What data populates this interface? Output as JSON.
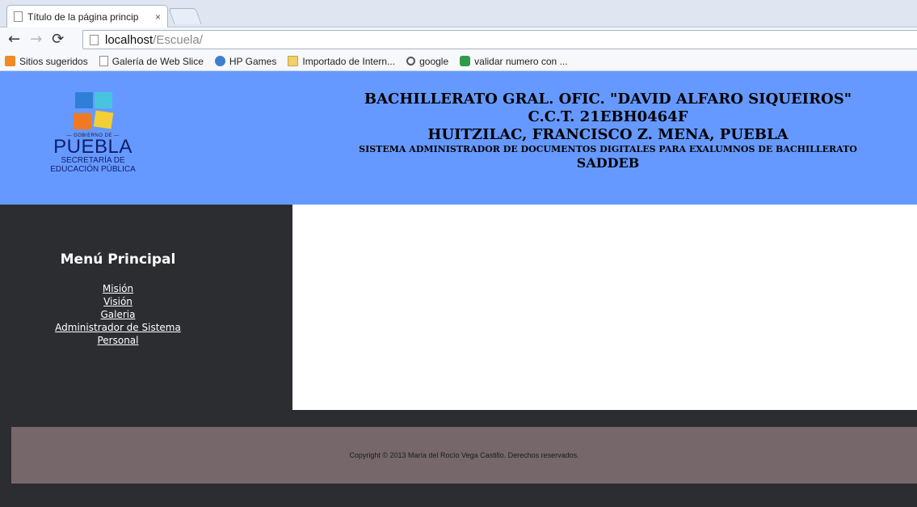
{
  "browser": {
    "tab_title": "Título de la página princip",
    "tab_close": "×",
    "url_host": "localhost",
    "url_path": "/Escuela/",
    "bookmarks": [
      {
        "label": "Sitios sugeridos",
        "icon": "suggested-sites-icon"
      },
      {
        "label": "Galería de Web Slice",
        "icon": "page-icon"
      },
      {
        "label": "HP Games",
        "icon": "hp-games-icon"
      },
      {
        "label": "Importado de Intern...",
        "icon": "folder-icon"
      },
      {
        "label": "google",
        "icon": "search-icon"
      },
      {
        "label": "validar numero con ...",
        "icon": "validator-icon"
      }
    ]
  },
  "header": {
    "logo": {
      "gobierno": "— GOBIERNO DE —",
      "puebla": "PUEBLA",
      "sep_line1": "SECRETARÍA DE",
      "sep_line2": "EDUCACIÓN PÚBLICA"
    },
    "line1": "BACHILLERATO GRAL. OFIC. \"DAVID ALFARO SIQUEIROS\"",
    "line2": "C.C.T. 21EBH0464F",
    "line3": "HUITZILAC, FRANCISCO Z. MENA, PUEBLA",
    "line4": "SISTEMA ADMINISTRADOR DE DOCUMENTOS DIGITALES PARA EXALUMNOS DE BACHILLERATO",
    "line5": "SADDEB"
  },
  "sidebar": {
    "title": "Menú Principal",
    "links": [
      "Misión",
      "Visión",
      "Galeria",
      "Administrador de Sistema",
      "Personal"
    ]
  },
  "footer": {
    "copyright": "Copyright © 2013 María del Rocío Vega Castillo. Derechos reservados."
  },
  "colors": {
    "header_bg": "#6699ff",
    "dark_bg": "#2c2d30",
    "footer_band": "#76686a"
  }
}
